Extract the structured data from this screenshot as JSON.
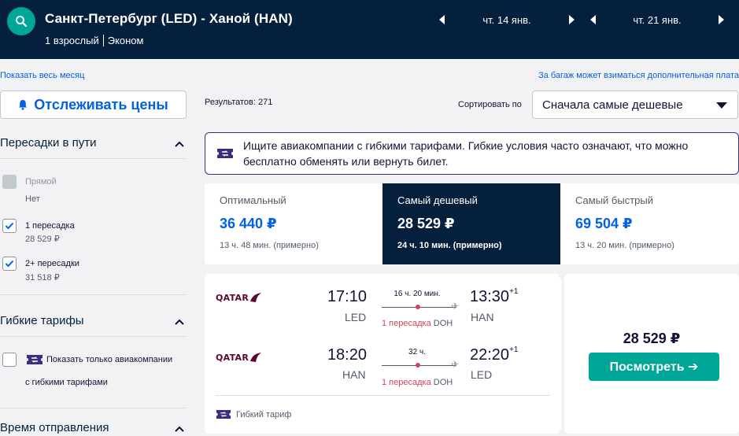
{
  "header": {
    "route": "Санкт-Петербург (LED) - Ханой (HAN)",
    "passengers": "1 взрослый",
    "cabin": "Эконом",
    "depart_date": "чт. 14 янв.",
    "return_date": "чт. 21 янв."
  },
  "links": {
    "show_month": "Показать весь месяц",
    "baggage_note": "За багаж может взиматься дополнительная плата"
  },
  "sidebar": {
    "track_prices": "Отслеживать цены",
    "stops": {
      "title": "Пересадки в пути",
      "options": [
        {
          "label": "Прямой",
          "price": "Нет",
          "checked": false,
          "disabled": true
        },
        {
          "label": "1 пересадка",
          "price": "28 529 ₽",
          "checked": true,
          "disabled": false
        },
        {
          "label": "2+ пересадки",
          "price": "31 518 ₽",
          "checked": true,
          "disabled": false
        }
      ]
    },
    "flex": {
      "title": "Гибкие тарифы",
      "option_line1": "Показать только авиакомпании",
      "option_line2": "с гибкими тарифами"
    },
    "departure_time_title": "Время отправления"
  },
  "main": {
    "results": "Результатов: 271",
    "sort_label": "Сортировать по",
    "sort_value": "Сначала самые дешевые",
    "info_text": "Ищите авиакомпании с гибкими тарифами. Гибкие условия часто означают, что можно бесплатно обменять или вернуть билет.",
    "tabs": [
      {
        "label": "Оптимальный",
        "price": "36 440 ₽",
        "duration": "13 ч. 48 мин. (примерно)",
        "active": false
      },
      {
        "label": "Самый дешевый",
        "price": "28 529 ₽",
        "duration": "24 ч. 10 мин. (примерно)",
        "active": true
      },
      {
        "label": "Самый быстрый",
        "price": "69 504 ₽",
        "duration": "13 ч. 20 мин. (примерно)",
        "active": false
      }
    ]
  },
  "card": {
    "airline_logo_text": "QATAR",
    "outbound": {
      "dep_time": "17:10",
      "dep_code": "LED",
      "arr_time": "13:30",
      "arr_offset": "+1",
      "arr_code": "HAN",
      "duration": "16 ч. 20 мин.",
      "stops": "1 пересадка",
      "stop_airport": "DOH"
    },
    "inbound": {
      "dep_time": "18:20",
      "dep_code": "HAN",
      "arr_time": "22:20",
      "arr_offset": "+1",
      "arr_code": "LED",
      "duration": "32 ч.",
      "stops": "1 пересадка",
      "stop_airport": "DOH"
    },
    "flex_tag": "Гибкий тариф",
    "price": "28 529 ₽",
    "view_button": "Посмотреть ➔"
  },
  "colors": {
    "navy": "#05203c",
    "teal": "#00a698",
    "link_blue": "#0062e3",
    "stop_red": "#d1435b",
    "flex_purple": "#3a2d7e"
  }
}
